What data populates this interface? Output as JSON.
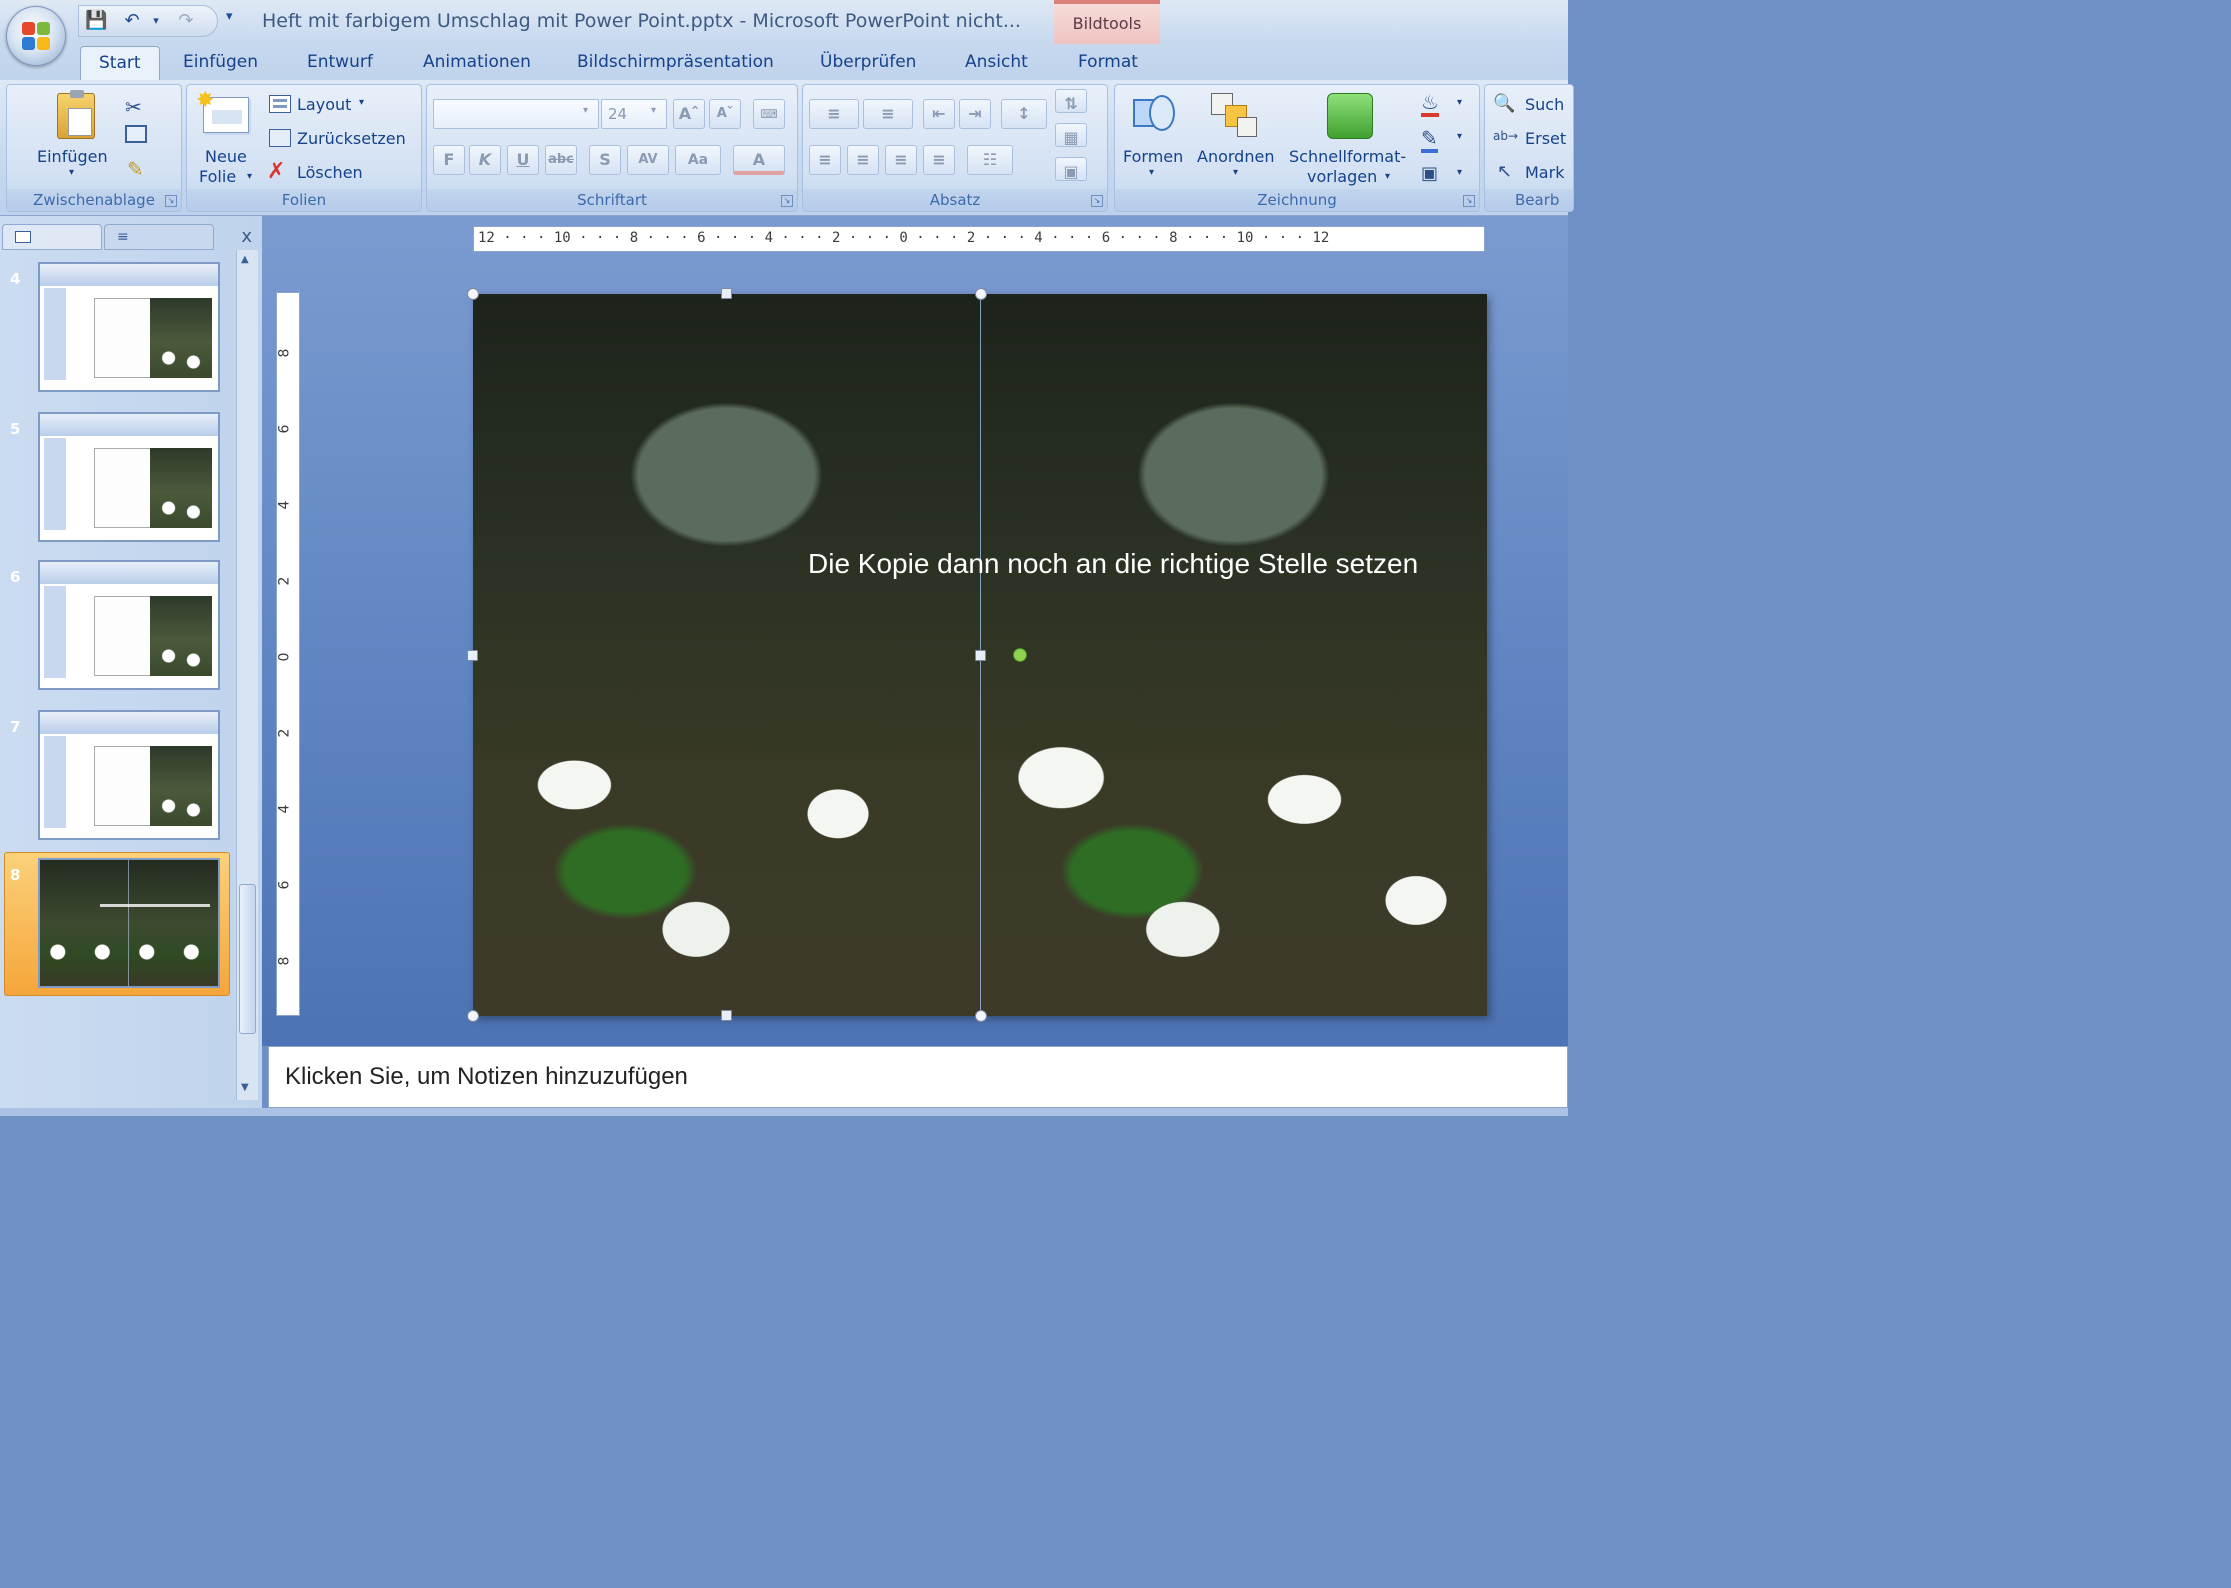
{
  "window": {
    "title": "Heft mit farbigem Umschlag mit Power Point.pptx - Microsoft PowerPoint nicht...",
    "contextual_tab_group": "Bildtools"
  },
  "ribbon_tabs": [
    "Start",
    "Einfügen",
    "Entwurf",
    "Animationen",
    "Bildschirmpräsentation",
    "Überprüfen",
    "Ansicht",
    "Format"
  ],
  "active_tab": "Start",
  "groups": {
    "clipboard": {
      "label": "Zwischenablage",
      "paste_label": "Einfügen"
    },
    "slides": {
      "label": "Folien",
      "new_slide_line1": "Neue",
      "new_slide_line2": "Folie",
      "layout": "Layout",
      "reset": "Zurücksetzen",
      "delete": "Löschen"
    },
    "font": {
      "label": "Schriftart",
      "font_name": "",
      "font_size": "24",
      "bold": "F",
      "italic": "K",
      "underline": "U",
      "strike": "abc",
      "shadow": "S",
      "spacing": "AV",
      "case": "Aa",
      "color": "A"
    },
    "paragraph": {
      "label": "Absatz"
    },
    "drawing": {
      "label": "Zeichnung",
      "shapes": "Formen",
      "arrange": "Anordnen",
      "quick_styles_line1": "Schnellformat-",
      "quick_styles_line2": "vorlagen"
    },
    "editing": {
      "label": "Bearb",
      "find": "Such",
      "replace": "Erset",
      "select": "Mark"
    }
  },
  "slide_pane": {
    "thumbnails": [
      {
        "number": "4"
      },
      {
        "number": "5"
      },
      {
        "number": "6"
      },
      {
        "number": "7"
      },
      {
        "number": "8",
        "selected": true
      }
    ],
    "close": "x"
  },
  "ruler_h": "12 · · · 10 · · · 8 · · · 6 · · · 4 · · · 2 · · · 0 · · · 2 · · · 4 · · · 6 · · · 8 · · · 10 · · · 12",
  "ruler_v": [
    "8",
    "6",
    "4",
    "2",
    "0",
    "2",
    "4",
    "6",
    "8"
  ],
  "slide": {
    "caption": "Die Kopie dann noch an die richtige Stelle setzen"
  },
  "notes": {
    "placeholder": "Klicken Sie, um  Notizen hinzuzufügen"
  },
  "colors": {
    "accent": "#15428b",
    "selection": "#f5a63a",
    "contextual": "#d9807b"
  }
}
